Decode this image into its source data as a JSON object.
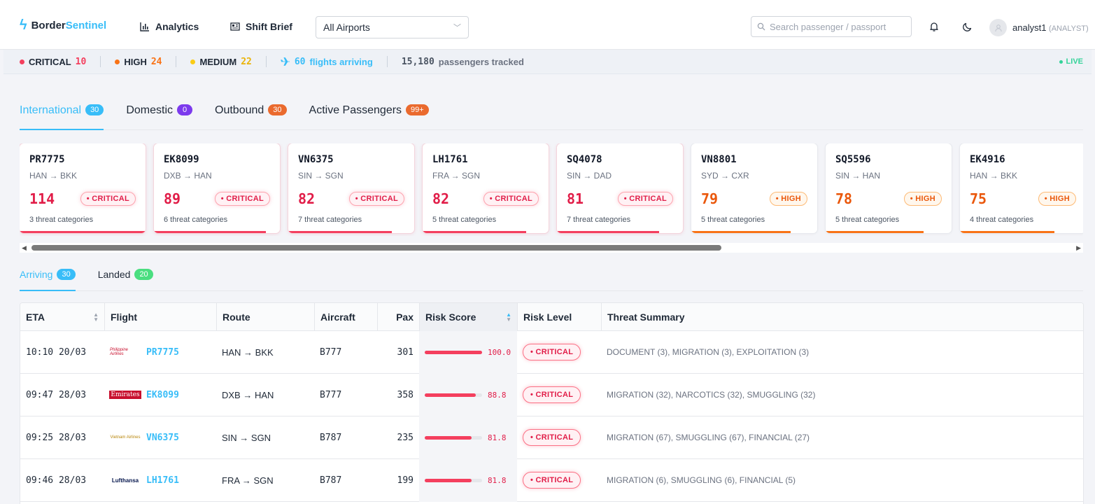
{
  "app": {
    "brand_main": "Border",
    "brand_accent": "Sentinel"
  },
  "nav": {
    "analytics": "Analytics",
    "shift_brief": "Shift Brief"
  },
  "airport_filter": {
    "value": "All Airports"
  },
  "search": {
    "placeholder": "Search passenger / passport"
  },
  "user": {
    "name": "analyst1",
    "role": "(ANALYST)"
  },
  "status": {
    "critical_label": "CRITICAL",
    "critical_count": "10",
    "high_label": "HIGH",
    "high_count": "24",
    "medium_label": "MEDIUM",
    "medium_count": "22",
    "flights_count": "60",
    "flights_label": "flights arriving",
    "pax_count": "15,180",
    "pax_label": "passengers tracked",
    "live": "LIVE"
  },
  "colors": {
    "accent": "#38bdf8",
    "critical": "#f43f5e",
    "high": "#f97316",
    "medium": "#facc15",
    "domestic": "#7c3aed",
    "outbound": "#ea6a2e",
    "landed": "#4ade80"
  },
  "tabs": [
    {
      "label": "International",
      "badge": "30"
    },
    {
      "label": "Domestic",
      "badge": "0"
    },
    {
      "label": "Outbound",
      "badge": "30"
    },
    {
      "label": "Active Passengers",
      "badge": "99+"
    }
  ],
  "cards": [
    {
      "flight": "PR7775",
      "route": "HAN → BKK",
      "score": "114",
      "level": "• CRITICAL",
      "cls": "critical",
      "cats": "3 threat categories",
      "bar": 1.0
    },
    {
      "flight": "EK8099",
      "route": "DXB → HAN",
      "score": "89",
      "level": "• CRITICAL",
      "cls": "critical",
      "cats": "6 threat categories",
      "bar": 0.89
    },
    {
      "flight": "VN6375",
      "route": "SIN → SGN",
      "score": "82",
      "level": "• CRITICAL",
      "cls": "critical",
      "cats": "7 threat categories",
      "bar": 0.82
    },
    {
      "flight": "LH1761",
      "route": "FRA → SGN",
      "score": "82",
      "level": "• CRITICAL",
      "cls": "critical",
      "cats": "5 threat categories",
      "bar": 0.82
    },
    {
      "flight": "SQ4078",
      "route": "SIN → DAD",
      "score": "81",
      "level": "• CRITICAL",
      "cls": "critical",
      "cats": "7 threat categories",
      "bar": 0.81
    },
    {
      "flight": "VN8801",
      "route": "SYD → CXR",
      "score": "79",
      "level": "• HIGH",
      "cls": "high",
      "cats": "5 threat categories",
      "bar": 0.79
    },
    {
      "flight": "SQ5596",
      "route": "SIN → HAN",
      "score": "78",
      "level": "• HIGH",
      "cls": "high",
      "cats": "5 threat categories",
      "bar": 0.78
    },
    {
      "flight": "EK4916",
      "route": "HAN → BKK",
      "score": "75",
      "level": "• HIGH",
      "cls": "high",
      "cats": "4 threat categories",
      "bar": 0.75
    }
  ],
  "subtabs": [
    {
      "label": "Arriving",
      "badge": "30"
    },
    {
      "label": "Landed",
      "badge": "20"
    }
  ],
  "table": {
    "headers": {
      "eta": "ETA",
      "flight": "Flight",
      "route": "Route",
      "aircraft": "Aircraft",
      "pax": "Pax",
      "risk_score": "Risk Score",
      "risk_level": "Risk Level",
      "threat_summary": "Threat Summary"
    },
    "rows": [
      {
        "eta": "10:10 20/03",
        "airline": "Philippine Airlines",
        "flight": "PR7775",
        "route": "HAN → BKK",
        "aircraft": "B777",
        "pax": "301",
        "risk": "100.0",
        "risk_frac": 1.0,
        "level": "• CRITICAL",
        "summary": "DOCUMENT (3), MIGRATION (3), EXPLOITATION (3)"
      },
      {
        "eta": "09:47 28/03",
        "airline": "Emirates",
        "flight": "EK8099",
        "route": "DXB → HAN",
        "aircraft": "B777",
        "pax": "358",
        "risk": "88.8",
        "risk_frac": 0.888,
        "level": "• CRITICAL",
        "summary": "MIGRATION (32), NARCOTICS (32), SMUGGLING (32)"
      },
      {
        "eta": "09:25 28/03",
        "airline": "Vietnam Airlines",
        "flight": "VN6375",
        "route": "SIN → SGN",
        "aircraft": "B787",
        "pax": "235",
        "risk": "81.8",
        "risk_frac": 0.818,
        "level": "• CRITICAL",
        "summary": "MIGRATION (67), SMUGGLING (67), FINANCIAL (27)"
      },
      {
        "eta": "09:46 28/03",
        "airline": "Lufthansa",
        "flight": "LH1761",
        "route": "FRA → SGN",
        "aircraft": "B787",
        "pax": "199",
        "risk": "81.8",
        "risk_frac": 0.818,
        "level": "• CRITICAL",
        "summary": "MIGRATION (6), SMUGGLING (6), FINANCIAL (5)"
      }
    ]
  }
}
